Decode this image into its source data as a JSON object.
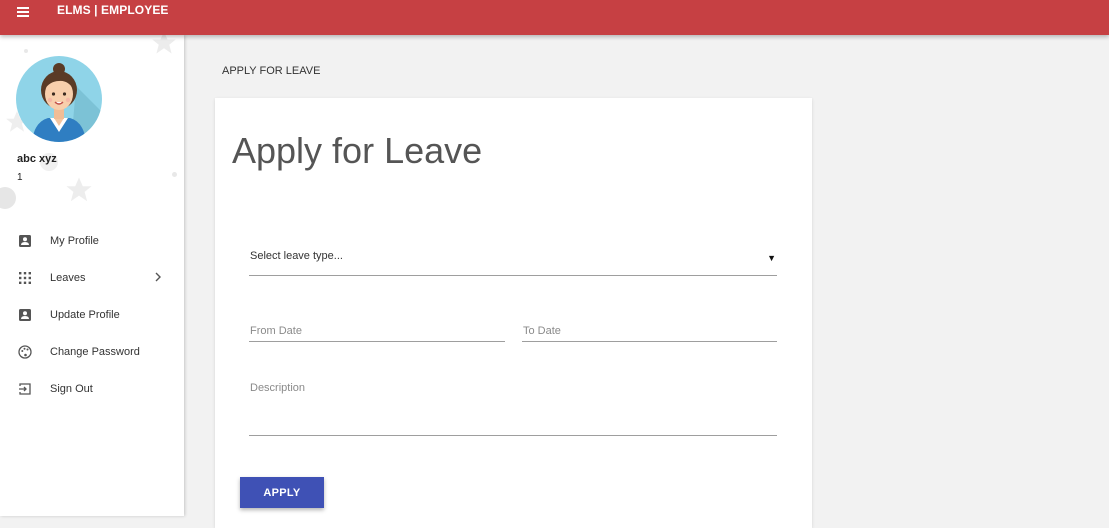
{
  "header": {
    "menu_icon": "hamburger-icon",
    "brand": "ELMS | EMPLOYEE",
    "color": "#c64043"
  },
  "sidebar": {
    "user": {
      "name": "abc xyz",
      "id": "1"
    },
    "items": [
      {
        "label": "My Profile",
        "icon": "account-box-icon"
      },
      {
        "label": "Leaves",
        "icon": "apps-grid-icon",
        "has_submenu": true
      },
      {
        "label": "Update Profile",
        "icon": "account-box-icon"
      },
      {
        "label": "Change Password",
        "icon": "palette-icon"
      },
      {
        "label": "Sign Out",
        "icon": "exit-icon"
      }
    ]
  },
  "main": {
    "breadcrumb": "APPLY FOR LEAVE",
    "card": {
      "title": "Apply for Leave",
      "leave_type": {
        "value": "Select leave type...",
        "caret": "▼"
      },
      "from_date": {
        "placeholder": "From Date"
      },
      "to_date": {
        "placeholder": "To Date"
      },
      "description": {
        "placeholder": "Description"
      },
      "apply_label": "APPLY",
      "button_color": "#3f51b5"
    }
  }
}
